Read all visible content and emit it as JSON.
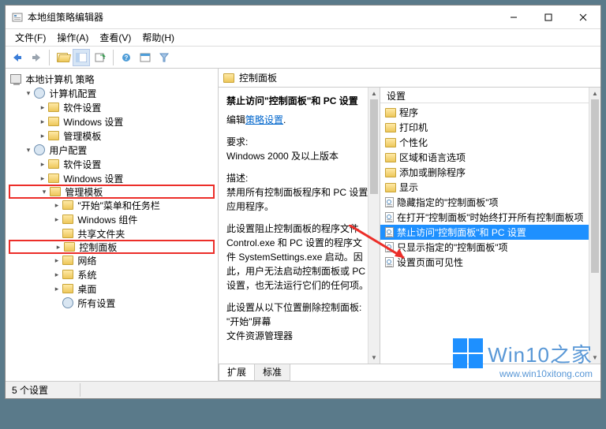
{
  "titlebar": {
    "title": "本地组策略编辑器"
  },
  "menu": {
    "file": "文件(F)",
    "action": "操作(A)",
    "view": "查看(V)",
    "help": "帮助(H)"
  },
  "tree": {
    "root": "本地计算机 策略",
    "computer_cfg": "计算机配置",
    "cc_software": "软件设置",
    "cc_windows": "Windows 设置",
    "cc_admin": "管理模板",
    "user_cfg": "用户配置",
    "uc_software": "软件设置",
    "uc_windows": "Windows 设置",
    "uc_admin": "管理模板",
    "start_taskbar": "\"开始\"菜单和任务栏",
    "win_components": "Windows 组件",
    "shared": "共享文件夹",
    "control_panel": "控制面板",
    "network": "网络",
    "system": "系统",
    "desktop": "桌面",
    "all_settings": "所有设置"
  },
  "right": {
    "header": "控制面板",
    "detail_title": "禁止访问\"控制面板\"和 PC 设置",
    "edit_prefix": "编辑",
    "edit_link": "策略设置",
    "req_label": "要求:",
    "req_value": "Windows 2000 及以上版本",
    "desc_label": "描述:",
    "desc1": "禁用所有控制面板程序和 PC 设置应用程序。",
    "desc2": "此设置阻止控制面板的程序文件 Control.exe 和 PC 设置的程序文件 SystemSettings.exe 启动。因此，用户无法启动控制面板或 PC 设置，也无法运行它们的任何项。",
    "desc3": "此设置从以下位置删除控制面板:",
    "desc4": "\"开始\"屏幕",
    "desc5": "文件资源管理器"
  },
  "list": {
    "column": "设置",
    "items": [
      {
        "type": "folder",
        "label": "程序"
      },
      {
        "type": "folder",
        "label": "打印机"
      },
      {
        "type": "folder",
        "label": "个性化"
      },
      {
        "type": "folder",
        "label": "区域和语言选项"
      },
      {
        "type": "folder",
        "label": "添加或删除程序"
      },
      {
        "type": "folder",
        "label": "显示"
      },
      {
        "type": "doc",
        "label": "隐藏指定的\"控制面板\"项"
      },
      {
        "type": "doc",
        "label": "在打开\"控制面板\"时始终打开所有控制面板项"
      },
      {
        "type": "doc",
        "label": "禁止访问\"控制面板\"和 PC 设置",
        "selected": true
      },
      {
        "type": "doc",
        "label": "只显示指定的\"控制面板\"项"
      },
      {
        "type": "doc",
        "label": "设置页面可见性"
      }
    ]
  },
  "tabs": {
    "extended": "扩展",
    "standard": "标准"
  },
  "status": "5 个设置",
  "watermark": {
    "title": "Win10之家",
    "sub": "www.win10xitong.com"
  }
}
